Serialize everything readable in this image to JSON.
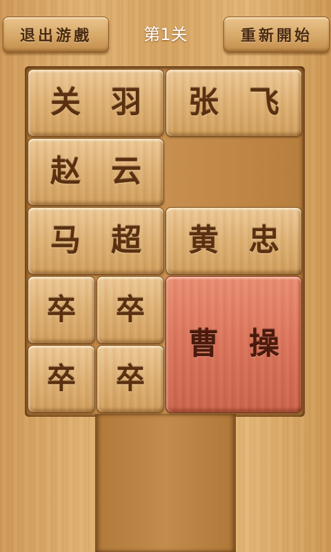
{
  "header": {
    "exit_label": "退出游戲",
    "level_title": "第1关",
    "restart_label": "重新開始"
  },
  "tiles": {
    "guanyu": [
      "关",
      "羽"
    ],
    "zhangfei": [
      "张",
      "飞"
    ],
    "zhaoyun": [
      "赵",
      "云"
    ],
    "machao": [
      "马",
      "超"
    ],
    "huangzhong": [
      "黄",
      "忠"
    ],
    "zu": [
      "卒",
      "卒",
      "卒",
      "卒"
    ],
    "caocao": [
      "曹",
      "操"
    ]
  },
  "colors": {
    "wood": "#ddb073",
    "caocao_red": "#d9735a",
    "glyph": "#5a3010",
    "title_text": "#ffffff"
  }
}
